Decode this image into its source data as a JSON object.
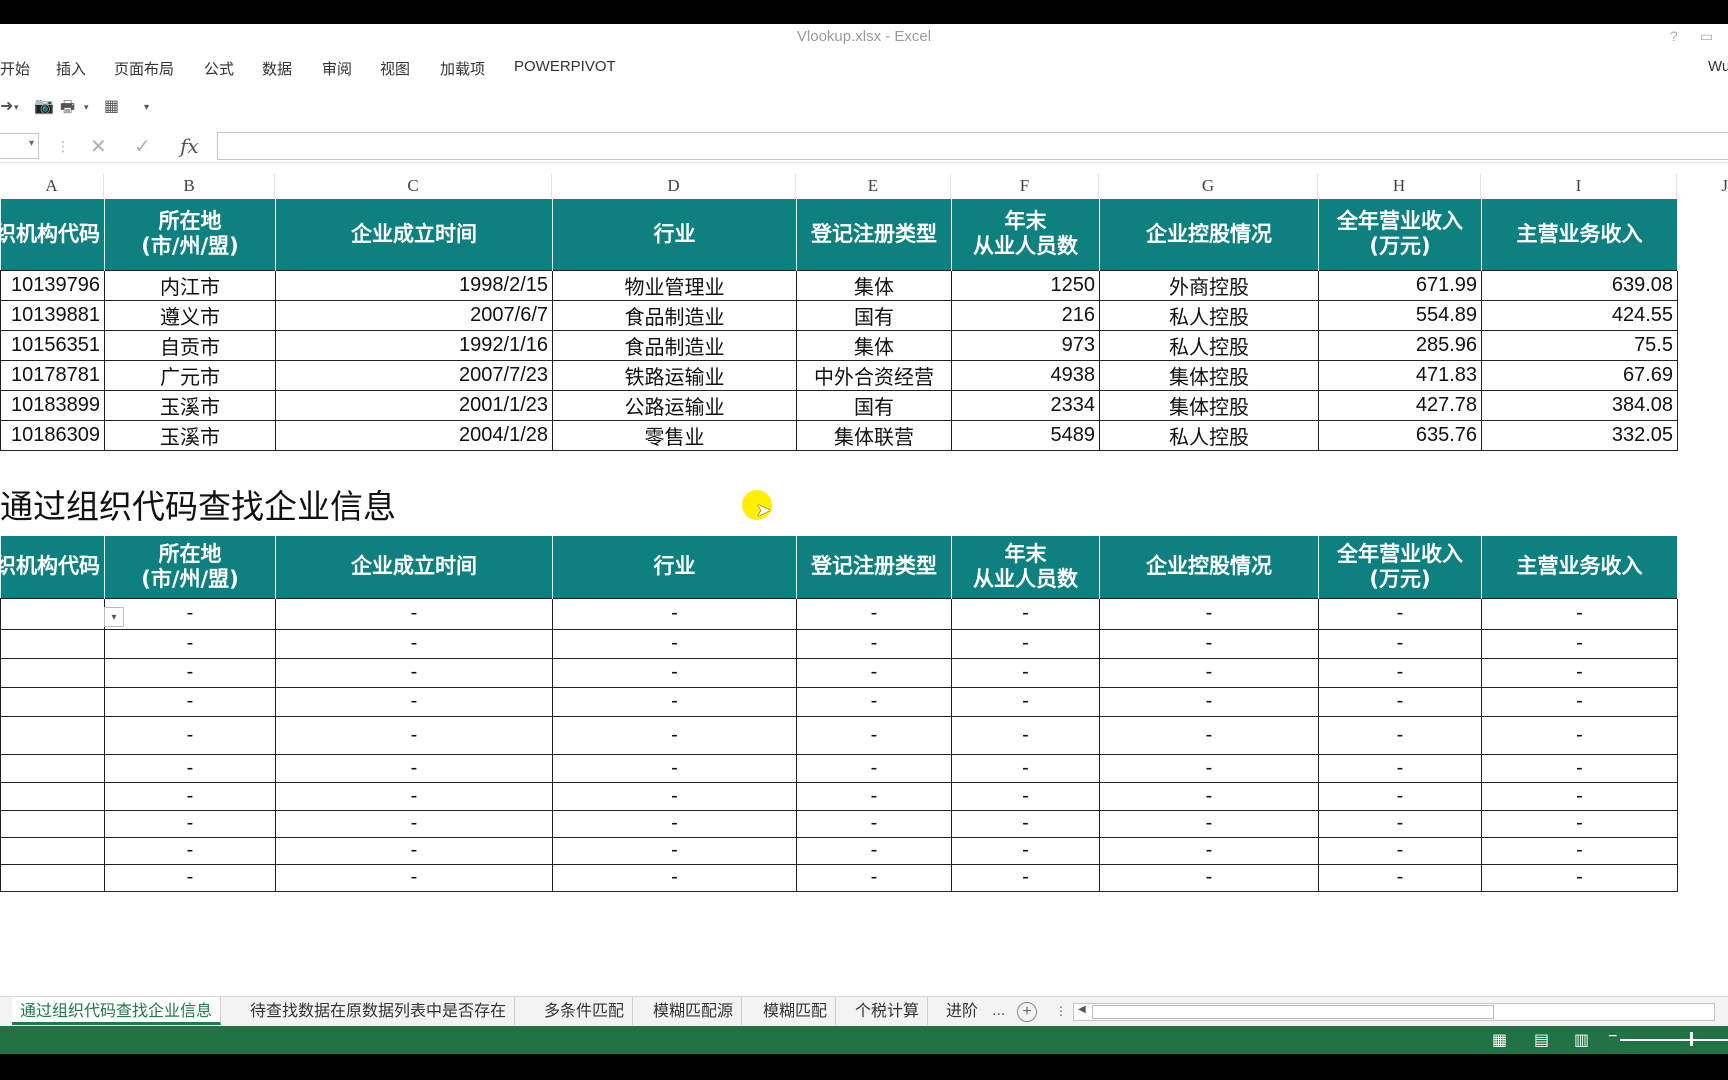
{
  "window": {
    "title": "Vlookup.xlsx - Excel"
  },
  "ribbon": {
    "tabs": [
      "开始",
      "插入",
      "页面布局",
      "公式",
      "数据",
      "审阅",
      "视图",
      "加载项",
      "POWERPIVOT"
    ],
    "user_fragment": "Wu"
  },
  "formula_bar": {
    "fx_label": "fx"
  },
  "columns": [
    "A",
    "B",
    "C",
    "D",
    "E",
    "F",
    "G",
    "H",
    "I",
    "J"
  ],
  "headers": [
    "组织机构代码",
    "所在地",
    "(市/州/盟)",
    "企业成立时间",
    "行业",
    "登记注册类型",
    "年末",
    "从业人员数",
    "企业控股情况",
    "全年营业收入",
    "(万元)",
    "主营业务收入"
  ],
  "rows": [
    [
      "10139796",
      "内江市",
      "1998/2/15",
      "物业管理业",
      "集体",
      "1250",
      "外商控股",
      "671.99",
      "639.08"
    ],
    [
      "10139881",
      "遵义市",
      "2007/6/7",
      "食品制造业",
      "国有",
      "216",
      "私人控股",
      "554.89",
      "424.55"
    ],
    [
      "10156351",
      "自贡市",
      "1992/1/16",
      "食品制造业",
      "集体",
      "973",
      "私人控股",
      "285.96",
      "75.5"
    ],
    [
      "10178781",
      "广元市",
      "2007/7/23",
      "铁路运输业",
      "中外合资经营",
      "4938",
      "集体控股",
      "471.83",
      "67.69"
    ],
    [
      "10183899",
      "玉溪市",
      "2001/1/23",
      "公路运输业",
      "国有",
      "2334",
      "集体控股",
      "427.78",
      "384.08"
    ],
    [
      "10186309",
      "玉溪市",
      "2004/1/28",
      "零售业",
      "集体联营",
      "5489",
      "私人控股",
      "635.76",
      "332.05"
    ]
  ],
  "section": {
    "title": "通过组织代码查找企业信息"
  },
  "lookup": {
    "empty": "-"
  },
  "sheets": [
    "通过组织代码查找企业信息",
    "待查找数据在原数据列表中是否存在",
    "多条件匹配",
    "模糊匹配源",
    "模糊匹配",
    "个税计算",
    "进阶"
  ],
  "sheets_more": "..."
}
